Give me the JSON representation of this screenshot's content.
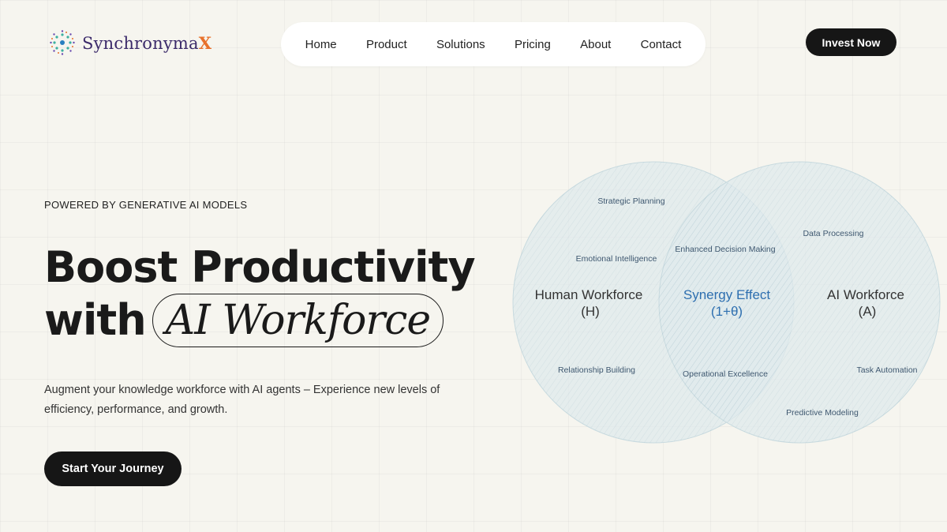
{
  "brand": {
    "name_main": "Synchronyma",
    "name_accent": "X",
    "accent_color": "#e8712b",
    "name_color": "#3b2a6a"
  },
  "nav": {
    "items": [
      {
        "label": "Home"
      },
      {
        "label": "Product"
      },
      {
        "label": "Solutions"
      },
      {
        "label": "Pricing"
      },
      {
        "label": "About"
      },
      {
        "label": "Contact"
      }
    ]
  },
  "header": {
    "invest_label": "Invest Now"
  },
  "hero": {
    "eyebrow": "POWERED BY GENERATIVE AI MODELS",
    "headline_line1": "Boost Productivity",
    "headline_with": "with",
    "headline_pill": "AI Workforce",
    "subtext": "Augment your knowledge workforce with AI agents – Experience new levels of efficiency, performance, and growth.",
    "cta_label": "Start Your Journey"
  },
  "venn": {
    "left_title": "Human Workforce",
    "left_sub": "(H)",
    "center_title": "Synergy Effect",
    "center_sub": "(1+θ)",
    "right_title": "AI Workforce",
    "right_sub": "(A)",
    "left_tags": [
      "Strategic Planning",
      "Emotional Intelligence",
      "Relationship Building"
    ],
    "center_tags": [
      "Enhanced Decision Making",
      "Operational Excellence"
    ],
    "right_tags": [
      "Data Processing",
      "Task Automation",
      "Predictive Modeling"
    ],
    "circle_fill": "#dfeaec",
    "center_color": "#2e6fb0"
  }
}
